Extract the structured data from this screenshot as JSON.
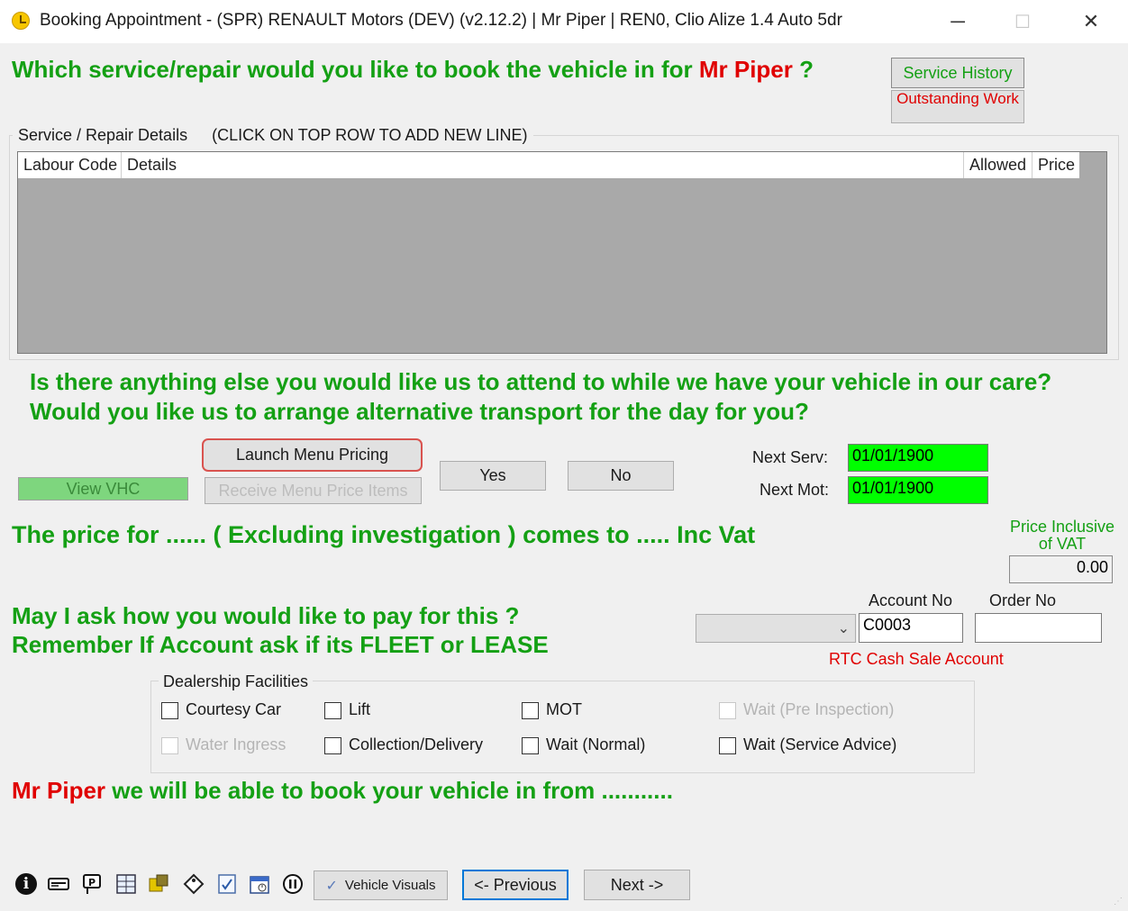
{
  "window": {
    "title": "Booking Appointment - (SPR) RENAULT Motors (DEV) (v2.12.2) | Mr Piper | REN0, Clio Alize 1.4 Auto 5dr",
    "controls": {
      "minimize": "─",
      "maximize": "☐",
      "close": "✕"
    }
  },
  "header": {
    "question_prefix": "Which service/repair would you like to book the vehicle in for",
    "customer_name": "Mr Piper",
    "question_suffix": "?",
    "service_history_label": "Service History",
    "outstanding_work_label": "Outstanding Work"
  },
  "repair_grid": {
    "group_label": "Service / Repair Details",
    "hint": "(CLICK ON TOP ROW TO ADD NEW LINE)",
    "columns": [
      "Labour Code",
      "Details",
      "Allowed",
      "Price"
    ],
    "rows": []
  },
  "prompts": {
    "line1": "Is there anything else you would like us to attend to while we have your vehicle in our care?",
    "line2": "Would you like us to arrange alternative transport for the day for you?"
  },
  "actions": {
    "view_vhc": "View VHC",
    "launch_menu_pricing": "Launch Menu Pricing",
    "receive_menu_price_items": "Receive Menu Price Items",
    "yes": "Yes",
    "no": "No"
  },
  "next_dates": {
    "next_serv_label": "Next Serv:",
    "next_serv_value": "01/01/1900",
    "next_mot_label": "Next Mot:",
    "next_mot_value": "01/01/1900"
  },
  "price": {
    "sentence": "The price for ...... ( Excluding investigation ) comes to ..... Inc Vat",
    "inclusive_label_line1": "Price Inclusive",
    "inclusive_label_line2": "of VAT",
    "inclusive_value": "0.00"
  },
  "payment": {
    "line1": "May I ask how you would like to pay for this ?",
    "line2": "Remember If Account  ask if its FLEET or LEASE",
    "payment_type_value": "",
    "account_no_label": "Account No",
    "account_no_value": "C0003",
    "order_no_label": "Order No",
    "order_no_value": "",
    "account_name": "RTC Cash Sale Account"
  },
  "facilities": {
    "group_label": "Dealership Facilities",
    "items": [
      {
        "label": "Courtesy Car",
        "checked": false,
        "enabled": true
      },
      {
        "label": "Lift",
        "checked": false,
        "enabled": true
      },
      {
        "label": "MOT",
        "checked": false,
        "enabled": true
      },
      {
        "label": "Wait (Pre Inspection)",
        "checked": false,
        "enabled": false
      },
      {
        "label": "Water Ingress",
        "checked": false,
        "enabled": false
      },
      {
        "label": "Collection/Delivery",
        "checked": false,
        "enabled": true
      },
      {
        "label": "Wait (Normal)",
        "checked": false,
        "enabled": true
      },
      {
        "label": "Wait (Service Advice)",
        "checked": false,
        "enabled": true
      }
    ]
  },
  "booking_from": {
    "customer_name": "Mr Piper",
    "text": "we will be able to book your vehicle in from ..........."
  },
  "footer": {
    "tool_icons": [
      "info-icon",
      "card-reader-icon",
      "parking-icon",
      "grid-icon",
      "parts-icon",
      "tag-icon",
      "check-doc-icon",
      "calendar-icon",
      "pause-icon"
    ],
    "vehicle_visuals_label": "Vehicle Visuals",
    "previous_label": "<- Previous",
    "next_label": "Next ->"
  },
  "colors": {
    "heading_green": "#14a014",
    "name_red": "#e00000",
    "date_field_green": "#00ff00",
    "highlight_border": "#d9534f"
  }
}
